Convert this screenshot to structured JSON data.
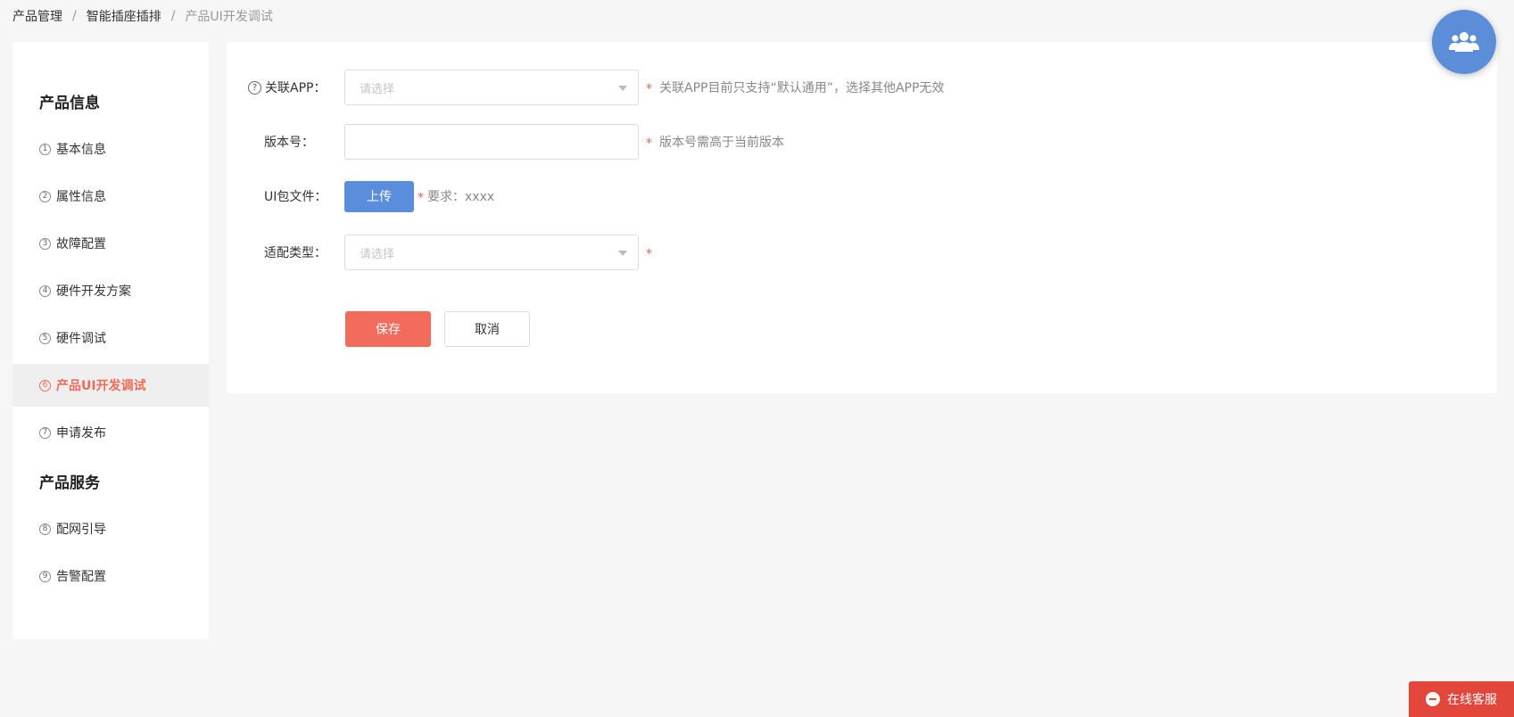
{
  "breadcrumb": {
    "items": [
      "产品管理",
      "智能插座插排",
      "产品UI开发调试"
    ],
    "separator": "/"
  },
  "sidebar": {
    "groups": [
      {
        "title": "产品信息"
      },
      {
        "title": "产品服务"
      }
    ],
    "items": [
      {
        "num": "1",
        "label": "基本信息"
      },
      {
        "num": "2",
        "label": "属性信息"
      },
      {
        "num": "3",
        "label": "故障配置"
      },
      {
        "num": "4",
        "label": "硬件开发方案"
      },
      {
        "num": "5",
        "label": "硬件调试"
      },
      {
        "num": "6",
        "label": "产品UI开发调试"
      },
      {
        "num": "7",
        "label": "申请发布"
      },
      {
        "num": "8",
        "label": "配网引导"
      },
      {
        "num": "9",
        "label": "告警配置"
      }
    ],
    "active_item": "产品UI开发调试"
  },
  "form": {
    "app": {
      "label": "关联APP：",
      "placeholder": "请选择",
      "required": "*",
      "hint": "关联APP目前只支持“默认通用”，选择其他APP无效"
    },
    "version": {
      "label": "版本号：",
      "value": "",
      "required": "*",
      "hint": "版本号需高于当前版本"
    },
    "ui_package": {
      "label": "UI包文件：",
      "button": "上传",
      "required": "*",
      "hint": "要求：xxxx"
    },
    "adapt_type": {
      "label": "适配类型：",
      "placeholder": "请选择",
      "required": "*"
    },
    "save_label": "保存",
    "cancel_label": "取消"
  },
  "support": {
    "label": "在线客服"
  },
  "colors": {
    "accent": "#f36b5d",
    "primary": "#5a8ddb",
    "support": "#e3463a"
  }
}
